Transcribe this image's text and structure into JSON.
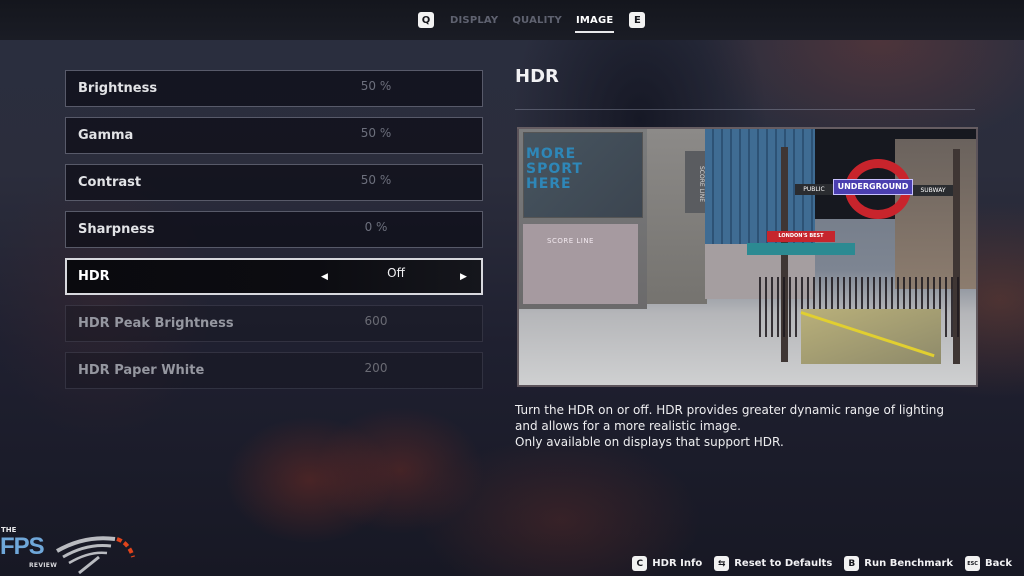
{
  "topbar": {
    "left_key": "Q",
    "right_key": "E",
    "tabs": [
      {
        "label": "DISPLAY",
        "active": false
      },
      {
        "label": "QUALITY",
        "active": false
      },
      {
        "label": "IMAGE",
        "active": true
      }
    ]
  },
  "settings": [
    {
      "label": "Brightness",
      "value": "50 %",
      "state": "normal"
    },
    {
      "label": "Gamma",
      "value": "50 %",
      "state": "normal"
    },
    {
      "label": "Contrast",
      "value": "50 %",
      "state": "normal"
    },
    {
      "label": "Sharpness",
      "value": "0 %",
      "state": "normal"
    },
    {
      "label": "HDR",
      "value": "Off",
      "state": "selected"
    },
    {
      "label": "HDR Peak Brightness",
      "value": "600",
      "state": "disabled"
    },
    {
      "label": "HDR Paper White",
      "value": "200",
      "state": "disabled"
    }
  ],
  "detail": {
    "title": "HDR",
    "preview": {
      "billboard_lines": [
        "MORE",
        "SPORT",
        "HERE"
      ],
      "shop_sign": "SCORE LINE",
      "vertical_sign": "SCORE LINE",
      "roundel_text": "UNDERGROUND",
      "left_sign": "PUBLIC",
      "right_sign": "SUBWAY",
      "banner": "LONDON'S BEST"
    },
    "description": [
      "Turn the HDR on or off. HDR provides greater dynamic range of lighting",
      "and allows for a more realistic image.",
      "Only available on displays that support HDR."
    ]
  },
  "footer": {
    "hints": [
      {
        "key": "C",
        "label": "HDR Info",
        "icon": "c-key-icon"
      },
      {
        "key": "⇆",
        "label": "Reset to Defaults",
        "icon": "reset-key-icon"
      },
      {
        "key": "B",
        "label": "Run Benchmark",
        "icon": "b-key-icon"
      },
      {
        "key": "ESC",
        "label": "Back",
        "icon": "esc-key-icon"
      }
    ]
  },
  "watermark": {
    "the": "THE",
    "fps": "FPS",
    "review": "REVIEW",
    "accent_color": "#e0441c",
    "brand_color": "#6fa7d9"
  },
  "colors": {
    "selected_border": "#d8d9de",
    "row_border": "#aaafc3",
    "value_text": "#6c6f7c"
  }
}
